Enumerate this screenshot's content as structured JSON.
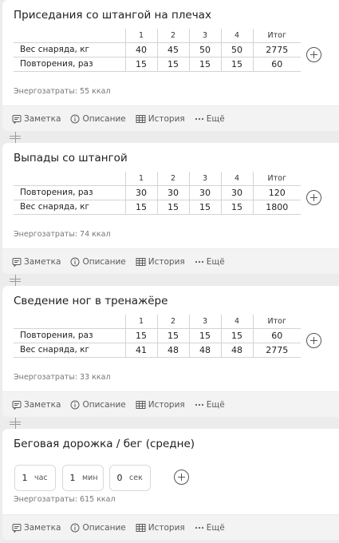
{
  "footer": {
    "note": "Заметка",
    "desc": "Описание",
    "history": "История",
    "more": "Ещё"
  },
  "icons": {
    "note": "note-icon",
    "info": "info-icon",
    "history": "table-icon",
    "more": "dots-icon",
    "add": "plus-circle-icon",
    "drag": "drag-handle-icon"
  },
  "exercises": [
    {
      "title": "Приседания со штангой на плечах",
      "headers": [
        "1",
        "2",
        "3",
        "4",
        "Итог"
      ],
      "rows": [
        {
          "label": "Вес снаряда, кг",
          "values": [
            "40",
            "45",
            "50",
            "50",
            "2775"
          ]
        },
        {
          "label": "Повторения, раз",
          "values": [
            "15",
            "15",
            "15",
            "15",
            "60"
          ]
        }
      ],
      "energy": "Энергозатраты: 55 ккал"
    },
    {
      "title": "Выпады со штангой",
      "headers": [
        "1",
        "2",
        "3",
        "4",
        "Итог"
      ],
      "rows": [
        {
          "label": "Повторения, раз",
          "values": [
            "30",
            "30",
            "30",
            "30",
            "120"
          ]
        },
        {
          "label": "Вес снаряда, кг",
          "values": [
            "15",
            "15",
            "15",
            "15",
            "1800"
          ]
        }
      ],
      "energy": "Энергозатраты: 74 ккал"
    },
    {
      "title": "Сведение ног в тренажёре",
      "headers": [
        "1",
        "2",
        "3",
        "4",
        "Итог"
      ],
      "rows": [
        {
          "label": "Повторения, раз",
          "values": [
            "15",
            "15",
            "15",
            "15",
            "60"
          ]
        },
        {
          "label": "Вес снаряда, кг",
          "values": [
            "41",
            "48",
            "48",
            "48",
            "2775"
          ]
        }
      ],
      "energy": "Энергозатраты: 33 ккал"
    }
  ],
  "cardio": {
    "title": "Беговая дорожка / бег (средне)",
    "hours": {
      "value": "1",
      "unit": "час"
    },
    "minutes": {
      "value": "1",
      "unit": "мин"
    },
    "seconds": {
      "value": "0",
      "unit": "сек"
    },
    "energy": "Энергозатраты: 615 ккал"
  }
}
